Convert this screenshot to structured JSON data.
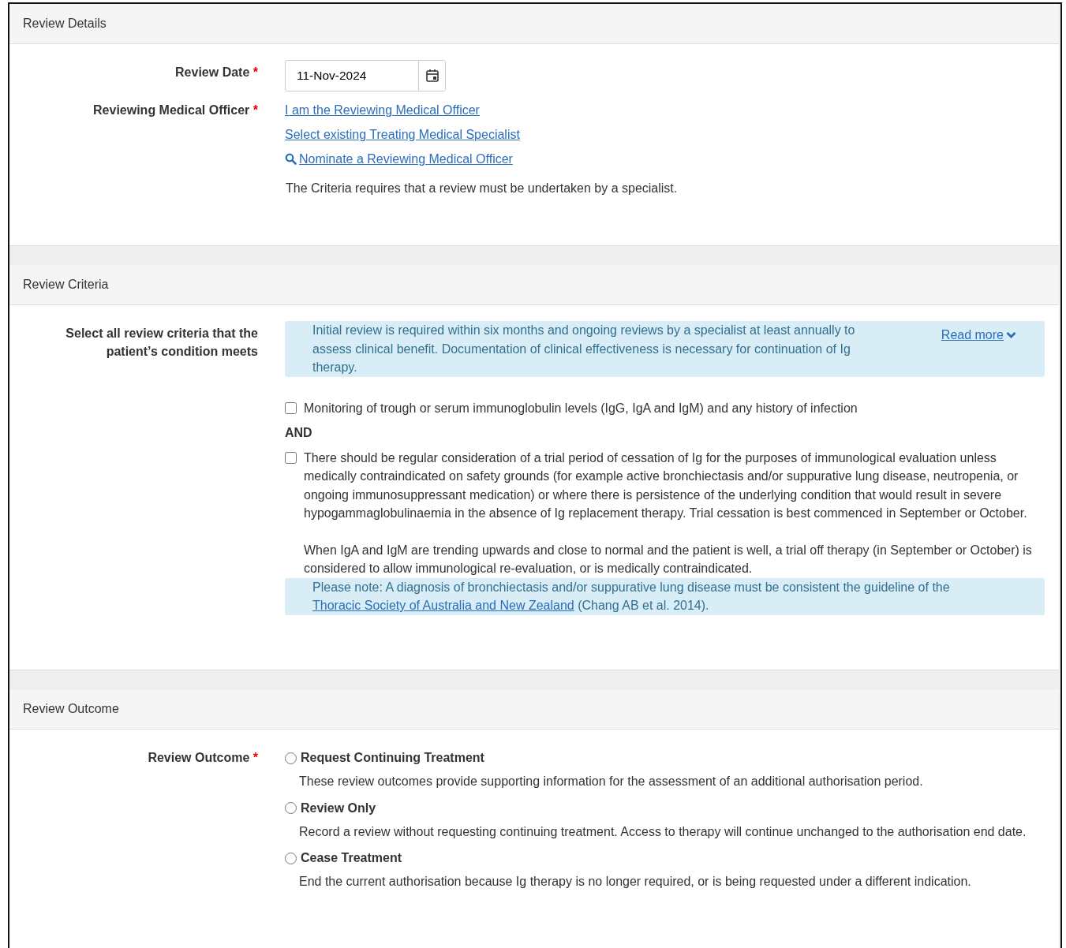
{
  "review_details": {
    "title": "Review Details",
    "review_date": {
      "label": "Review Date",
      "required_mark": "*",
      "value": "11-Nov-2024"
    },
    "medical_officer": {
      "label": "Reviewing Medical Officer",
      "required_mark": "*",
      "links": [
        {
          "text": "I am the Reviewing Medical Officer",
          "kind": "plain"
        },
        {
          "text": "Select existing Treating Medical Specialist",
          "kind": "plain"
        },
        {
          "text": "Nominate a Reviewing Medical Officer",
          "kind": "search"
        }
      ],
      "note": "The Criteria requires that a review must be undertaken by a specialist."
    }
  },
  "review_criteria": {
    "title": "Review Criteria",
    "label": "Select all review criteria that the patient’s condition meets",
    "info": {
      "text": "Initial review is required within six months and ongoing reviews by a specialist at least annually to assess clinical benefit. Documentation of clinical effectiveness is necessary for continuation of Ig therapy.",
      "read_more": "Read more"
    },
    "criteria": [
      {
        "kind": "checkbox",
        "checked": false,
        "paragraphs": [
          "Monitoring of trough or serum immunoglobulin levels (IgG, IgA and IgM) and any history of infection"
        ]
      },
      {
        "kind": "connector",
        "text": "AND"
      },
      {
        "kind": "checkbox",
        "checked": false,
        "paragraphs": [
          "There should be regular consideration of a trial period of cessation of Ig for the purposes of immunological evaluation unless medically contraindicated on safety grounds (for example active bronchiectasis and/or suppurative lung disease, neutropenia, or ongoing immunosuppressant medication) or where there is persistence of the underlying condition that would result in severe hypogammaglobulinaemia in the absence of Ig replacement therapy. Trial cessation is best commenced in September or October.",
          "When IgA and IgM are trending upwards and close to normal and the patient is well, a trial off therapy (in September or October) is considered to allow immunological re-evaluation, or is medically contraindicated."
        ]
      }
    ],
    "note": {
      "prefix": "Please note: A diagnosis of bronchiectasis and/or suppurative lung disease must be consistent the guideline of the",
      "link": "Thoracic Society of Australia and New Zealand",
      "suffix": "(Chang AB et al. 2014)."
    }
  },
  "review_outcome": {
    "title": "Review Outcome",
    "label": "Review Outcome",
    "required_mark": "*",
    "options": [
      {
        "label": "Request Continuing Treatment",
        "selected": false,
        "description": "These review outcomes provide supporting information for the assessment of an additional authorisation period."
      },
      {
        "label": "Review Only",
        "selected": false,
        "description": "Record a review without requesting continuing treatment. Access to therapy will continue unchanged to the authorisation end date."
      },
      {
        "label": "Cease Treatment",
        "selected": false,
        "description": "End the current authorisation because Ig therapy is no longer required, or is being requested under a different indication."
      }
    ]
  }
}
